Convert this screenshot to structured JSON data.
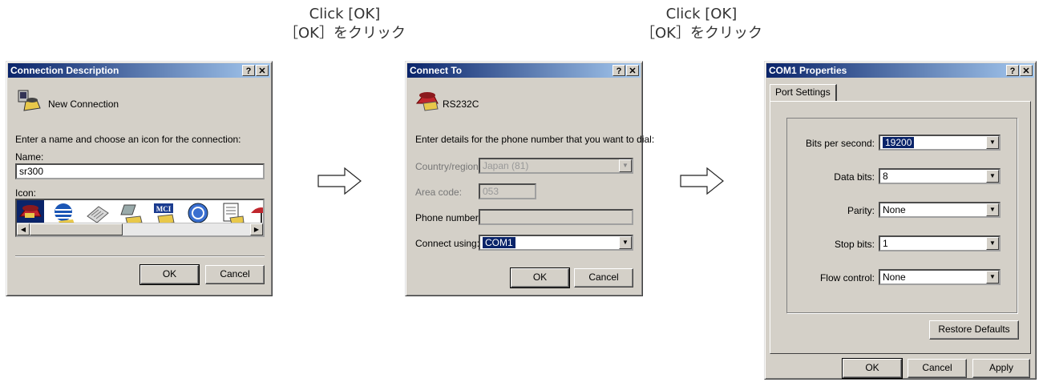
{
  "captions": [
    {
      "line1": "Click [OK]",
      "line2": "［OK］をクリック"
    },
    {
      "line1": "Click [OK]",
      "line2": "［OK］をクリック"
    }
  ],
  "dialog1": {
    "title": "Connection Description",
    "title_buttons": [
      "?",
      "✕"
    ],
    "heading": "New Connection",
    "prompt": "Enter a name and choose an icon for the connection:",
    "name_label": "Name:",
    "name_value": "sr300",
    "icon_label": "Icon:",
    "icons": [
      "phone-icon",
      "globe-phone-icon",
      "fax-icon",
      "satellite-phone-icon",
      "mci-phone-icon",
      "ge-phone-icon",
      "document-phone-icon",
      "umbrella-phone-icon"
    ],
    "ok": "OK",
    "cancel": "Cancel"
  },
  "dialog2": {
    "title": "Connect To",
    "title_buttons": [
      "?",
      "✕"
    ],
    "heading": "RS232C",
    "prompt": "Enter details for the phone number that you want to dial:",
    "country_label": "Country/region:",
    "country_value": "Japan (81)",
    "area_label": "Area code:",
    "area_value": "053",
    "phone_label": "Phone number:",
    "phone_value": "",
    "connect_label": "Connect using:",
    "connect_value": "COM1",
    "ok": "OK",
    "cancel": "Cancel"
  },
  "dialog3": {
    "title": "COM1 Properties",
    "title_buttons": [
      "?",
      "✕"
    ],
    "tab": "Port Settings",
    "fields": [
      {
        "label": "Bits per second:",
        "value": "19200"
      },
      {
        "label": "Data bits:",
        "value": "8"
      },
      {
        "label": "Parity:",
        "value": "None"
      },
      {
        "label": "Stop bits:",
        "value": "1"
      },
      {
        "label": "Flow control:",
        "value": "None"
      }
    ],
    "restore": "Restore Defaults",
    "ok": "OK",
    "cancel": "Cancel",
    "apply": "Apply"
  },
  "colors": {
    "titlebar_start": "#0a246a",
    "titlebar_end": "#a6caf0",
    "face": "#d4d0c8",
    "highlight": "#0a246a"
  }
}
